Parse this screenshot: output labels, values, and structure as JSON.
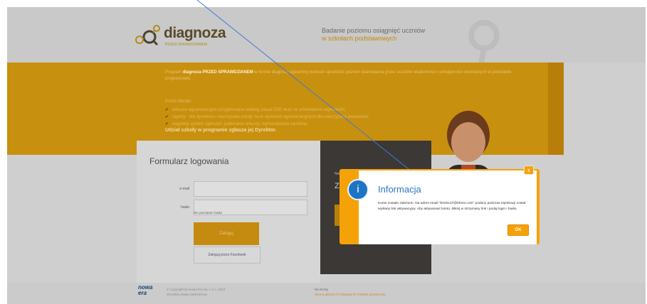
{
  "header": {
    "logo_text": "diagnoza",
    "logo_sub": "PRZED SPRAWDZIANEM",
    "tagline_line1": "Badanie poziomu osiągnięć uczniów",
    "tagline_line2": "w szkołach podstawowych"
  },
  "intro": {
    "text_before": "Program ",
    "text_bold": "diagnoza PRZED SPRAWDZIANEM",
    "text_after": " w formie diagnozy egzaminy pomoże sprawdzić poziom opanowania przez uczniów wiadomości i umiejętności określonych w podstawie programowej.",
    "offer_label": "Portal oferuje:",
    "bullets": [
      "arkusze egzaminacyjne przygotowane według zasad CKE wraz ze schematami odpowiedzi,",
      "raporty - dla dyrektora i nauczyciela szkoły na te wynikach egzaminacyjnych dla nauczyciela wskazówki,",
      "wygodny system zgłoszeń, pobieranie arkuszy, wprowadzanie wyników."
    ],
    "cta": "Udział szkoły w programie zgłasza jej Dyrektor."
  },
  "login": {
    "title": "Formularz logowania",
    "email_label": "e-mail",
    "password_label": "hasło",
    "forgot": "Nie pamiętam hasła",
    "submit": "Zaloguj",
    "facebook": "Zaloguj przez Facebook"
  },
  "panel": {
    "line1": "Nie masz konta?",
    "line2": "Załóż"
  },
  "footer": {
    "brand_line1": "nowa",
    "brand_line2": "era",
    "copyright": "© Copyright by Nowa Era Sp. z o.o. 2014",
    "rights": "Wszelkie prawa zastrzeżone",
    "follow": "Na skróty",
    "links": "Strona główna (?)   Regulamin   Polityka prywatności"
  },
  "modal": {
    "title": "Informacja",
    "message": "Konto zostało założone. Na adres email \"b045137@trbvm.com\" podany podczas rejestracji został wysłany link aktywacyjny. Aby aktywować konto, kliknij w otrzymany link i podaj login i hasło.",
    "ok": "OK",
    "close": "x"
  },
  "colors": {
    "accent": "#f5a208",
    "info_blue": "#1e73c4"
  }
}
